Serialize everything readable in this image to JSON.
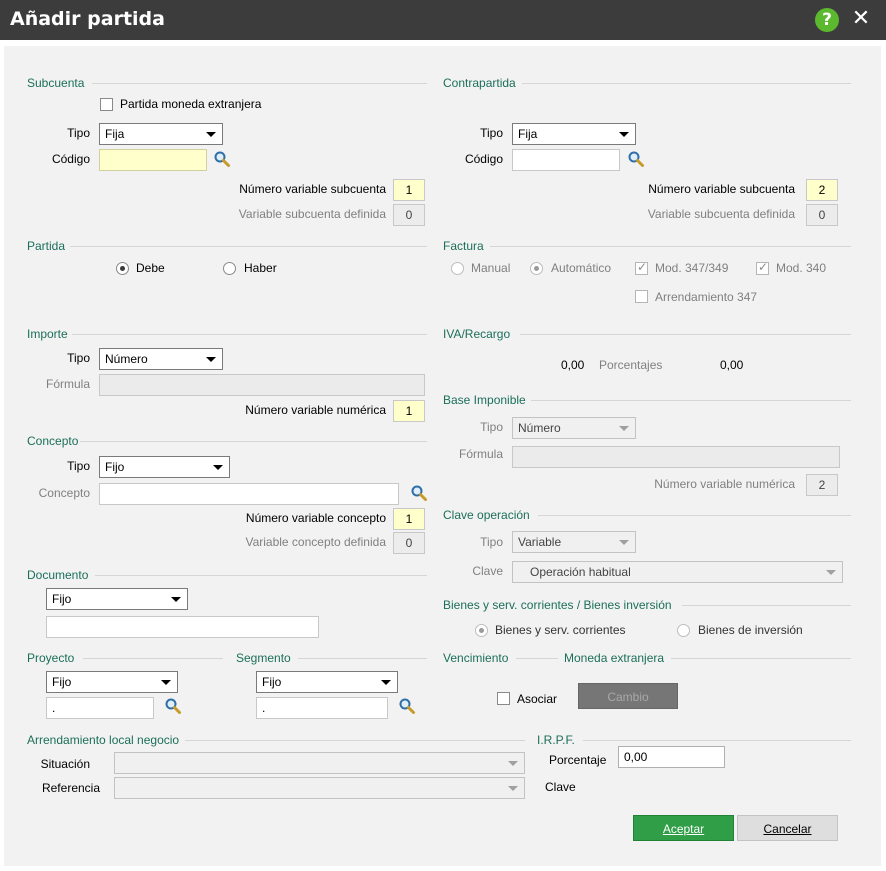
{
  "window": {
    "title": "Añadir partida",
    "help_icon": "question-circle-icon",
    "close_icon": "close-icon"
  },
  "subcuenta": {
    "section": "Subcuenta",
    "moneda_extranjera_label": "Partida moneda extranjera",
    "tipo_label": "Tipo",
    "tipo_value": "Fija",
    "codigo_label": "Código",
    "codigo_value": "",
    "num_var_label": "Número variable subcuenta",
    "num_var_value": "1",
    "var_def_label": "Variable subcuenta definida",
    "var_def_value": "0"
  },
  "contrapartida": {
    "section": "Contrapartida",
    "tipo_label": "Tipo",
    "tipo_value": "Fija",
    "codigo_label": "Código",
    "codigo_value": "",
    "num_var_label": "Número variable subcuenta",
    "num_var_value": "2",
    "var_def_label": "Variable subcuenta definida",
    "var_def_value": "0"
  },
  "partida": {
    "section": "Partida",
    "debe": "Debe",
    "haber": "Haber"
  },
  "factura": {
    "section": "Factura",
    "manual": "Manual",
    "automatico": "Automático",
    "mod347": "Mod. 347/349",
    "mod340": "Mod. 340",
    "arrendamiento": "Arrendamiento 347"
  },
  "importe": {
    "section": "Importe",
    "tipo_label": "Tipo",
    "tipo_value": "Número",
    "formula_label": "Fórmula",
    "num_var_label": "Número variable numérica",
    "num_var_value": "1"
  },
  "iva": {
    "section": "IVA/Recargo",
    "value1": "0,00",
    "porcentajes": "Porcentajes",
    "value2": "0,00"
  },
  "base": {
    "section": "Base Imponible",
    "tipo_label": "Tipo",
    "tipo_value": "Número",
    "formula_label": "Fórmula",
    "num_var_label": "Número variable numérica",
    "num_var_value": "2"
  },
  "concepto": {
    "section": "Concepto",
    "tipo_label": "Tipo",
    "tipo_value": "Fijo",
    "concepto_label": "Concepto",
    "num_var_label": "Número variable concepto",
    "num_var_value": "1",
    "var_def_label": "Variable concepto definida",
    "var_def_value": "0"
  },
  "clave_op": {
    "section": "Clave operación",
    "tipo_label": "Tipo",
    "tipo_value": "Variable",
    "clave_label": "Clave",
    "clave_value": "Operación habitual"
  },
  "documento": {
    "section": "Documento",
    "tipo_value": "Fijo"
  },
  "bienes": {
    "section": "Bienes y serv. corrientes / Bienes inversión",
    "corrientes": "Bienes y serv. corrientes",
    "inversion": "Bienes de inversión"
  },
  "proyecto": {
    "section": "Proyecto",
    "tipo_value": "Fijo",
    "input_value": "."
  },
  "segmento": {
    "section": "Segmento",
    "tipo_value": "Fijo",
    "input_value": "."
  },
  "vencimiento": {
    "section": "Vencimiento"
  },
  "moneda": {
    "section": "Moneda extranjera",
    "asociar": "Asociar",
    "cambio": "Cambio"
  },
  "arrendamiento": {
    "section": "Arrendamiento local negocio",
    "situacion_label": "Situación",
    "referencia_label": "Referencia"
  },
  "irpf": {
    "section": "I.R.P.F.",
    "porcentaje_label": "Porcentaje",
    "porcentaje_value": "0,00",
    "clave_label": "Clave"
  },
  "buttons": {
    "aceptar": "Aceptar",
    "cancelar": "Cancelar"
  },
  "colors": {
    "accent_green": "#2f9e46",
    "section_text": "#1b6f59",
    "highlight_yellow": "#ffffcc",
    "titlebar": "#3c3c3c"
  }
}
